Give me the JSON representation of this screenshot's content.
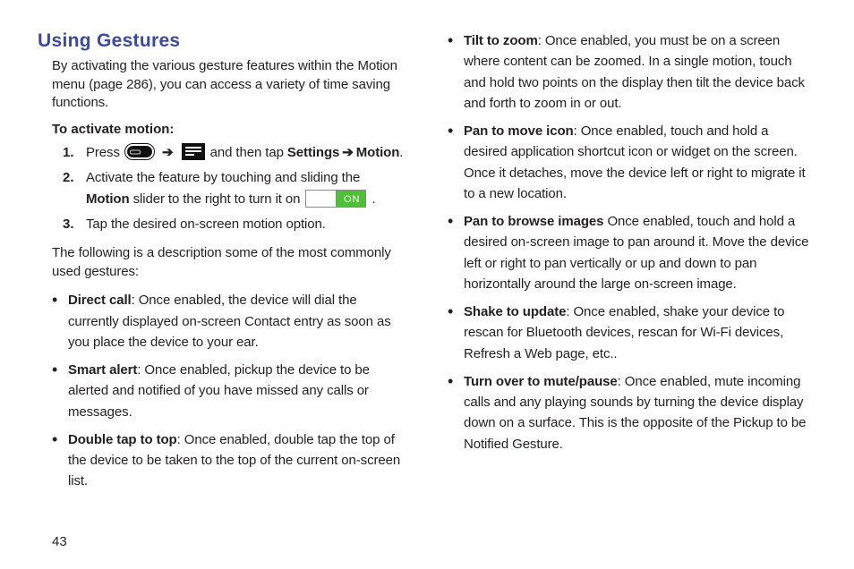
{
  "pageNumber": "43",
  "heading": "Using Gestures",
  "intro": "By activating the various gesture features within the Motion menu (page 286), you can access a variety of time saving functions.",
  "subhead": "To activate motion:",
  "steps": {
    "s1": {
      "num": "1.",
      "pre": "Press ",
      "mid": " ➔ ",
      "mid2": " and then tap ",
      "bold1": "Settings",
      "arrow": " ➔ ",
      "bold2": "Motion",
      "post": "."
    },
    "s2": {
      "num": "2.",
      "pre": "Activate the feature by touching and sliding the ",
      "bold": "Motion",
      "post1": " slider to the right to turn it on ",
      "post2": " .",
      "switchLabel": "ON"
    },
    "s3": {
      "num": "3.",
      "text": "Tap the desired on-screen motion option."
    }
  },
  "desc": "The following is a description some of the most commonly used gestures:",
  "left": {
    "b1": {
      "bold": "Direct call",
      "text": ": Once enabled, the device will dial the currently displayed on-screen Contact entry as soon as you place the device to your ear."
    },
    "b2": {
      "bold": "Smart alert",
      "text": ": Once enabled, pickup the device to be alerted and notified of you have missed any calls or messages."
    },
    "b3": {
      "bold": "Double tap to top",
      "text": ": Once enabled, double tap the top of the device to be taken to the top of the current on-screen list."
    }
  },
  "right": {
    "b1": {
      "bold": "Tilt to zoom",
      "text": ": Once enabled, you must be on a screen where content can be zoomed. In a single motion, touch and hold two points on the display then tilt the device back and forth to zoom in or out."
    },
    "b2": {
      "bold": "Pan to move icon",
      "text": ": Once enabled, touch and hold a desired application shortcut icon or widget on the screen. Once it detaches, move the device left or right to migrate it to a new location."
    },
    "b3": {
      "bold": "Pan to browse images",
      "text": " Once enabled, touch and hold a desired on-screen image to pan around it. Move the device left or right to pan vertically or up and down to pan horizontally around the large on-screen image."
    },
    "b4": {
      "bold": "Shake to update",
      "text": ": Once enabled, shake your device to rescan for Bluetooth devices, rescan for Wi-Fi devices, Refresh a Web page, etc.."
    },
    "b5": {
      "bold": "Turn over to mute/pause",
      "text": ": Once enabled, mute incoming calls and any playing sounds by turning the device display down on a surface. This is the opposite of the Pickup to be Notified Gesture."
    }
  }
}
